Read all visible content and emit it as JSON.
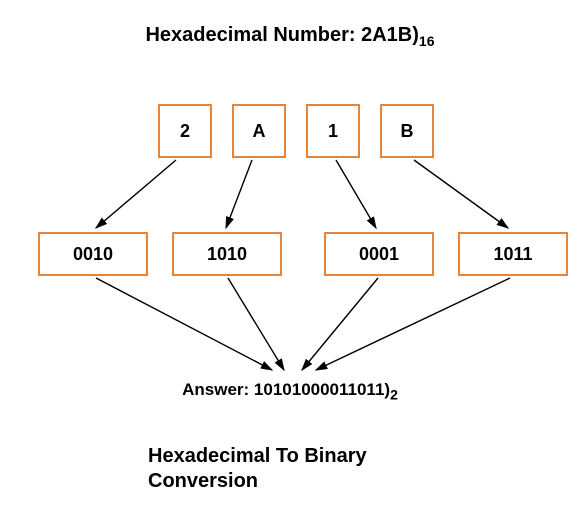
{
  "title_prefix": "Hexadecimal Number: 2A1B)",
  "title_sub": "16",
  "hex": [
    {
      "char": "2",
      "bin": "0010"
    },
    {
      "char": "A",
      "bin": "1010"
    },
    {
      "char": "1",
      "bin": "0001"
    },
    {
      "char": "B",
      "bin": "1011"
    }
  ],
  "answer_prefix": "Answer: 10101000011011)",
  "answer_sub": "2",
  "footer": "Hexadecimal To Binary Conversion",
  "colors": {
    "box_border": "#e8833a",
    "text": "#000000"
  },
  "diagram_type": "hex-to-binary-conversion"
}
